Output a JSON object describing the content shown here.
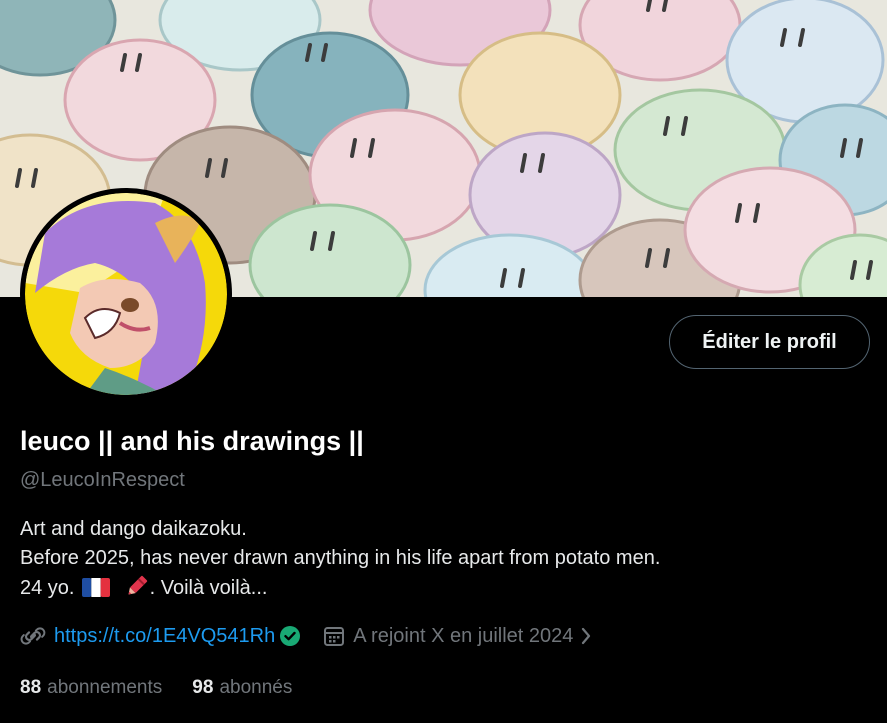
{
  "profile": {
    "display_name": "leuco || and his drawings ||",
    "handle": "@LeucoInRespect",
    "edit_button": "Éditer le profil",
    "bio": {
      "line1": "Art and dango daikazoku.",
      "line2": "Before 2025, has never drawn anything in his life apart from potato men.",
      "line3_start": "24 yo.",
      "line3_end": ". Voilà voilà..."
    },
    "link": "https://t.co/1E4VQ541Rh",
    "joined": "A rejoint X en juillet 2024",
    "following_count": "88",
    "following_label": "abonnements",
    "followers_count": "98",
    "followers_label": "abonnés"
  },
  "icons": {
    "link": "link-icon",
    "verified": "verified-check-icon",
    "calendar": "calendar-icon",
    "chevron": "chevron-right-icon",
    "flag": "france-flag-emoji",
    "crayon": "crayon-emoji"
  },
  "colors": {
    "background": "#000000",
    "link": "#1d9bf0",
    "muted": "#71767b",
    "text": "#e7e9ea",
    "verified": "#00ba7c"
  }
}
